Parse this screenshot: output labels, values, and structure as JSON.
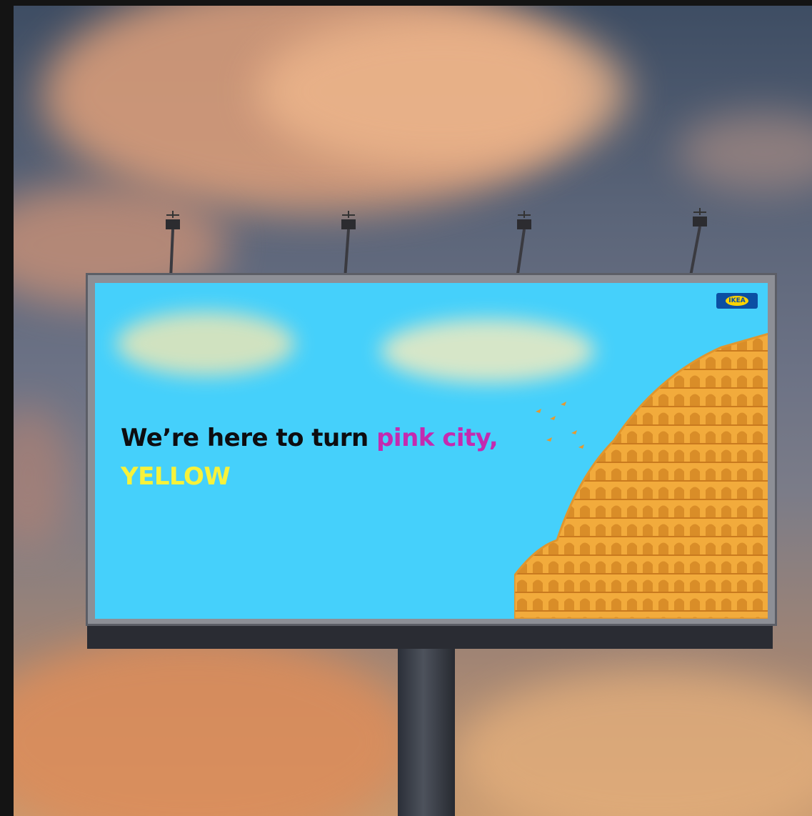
{
  "billboard": {
    "headline_part1": "We’re here to turn ",
    "headline_part2": "pink city,",
    "headline_part3": "YELLOW",
    "logo": "IKEA",
    "colors": {
      "background": "#45d0fb",
      "headline": "#0d0d10",
      "pink": "#c42ab0",
      "yellow": "#f7f23a",
      "palace": "#f0a83a"
    }
  },
  "scene": {
    "subject": "billboard-on-pole",
    "sky": "sunset-clouds"
  }
}
